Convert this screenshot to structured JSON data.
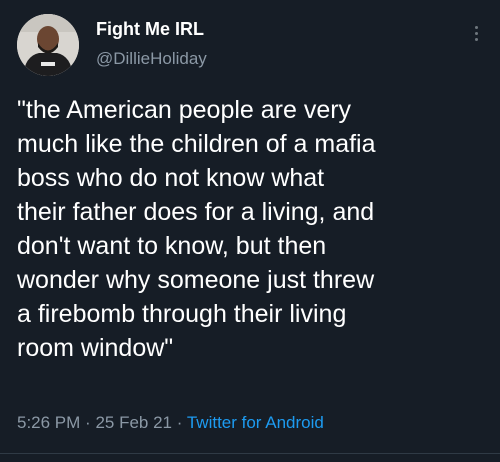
{
  "user": {
    "display_name": "Fight Me IRL",
    "handle": "@DillieHoliday"
  },
  "tweet": {
    "lines": [
      "\"the American people are very",
      "much like the children of a mafia",
      "boss who do not know what",
      "their father does for a living, and",
      "don't want to know, but then",
      "wonder why someone just threw",
      "a firebomb through their living",
      "room window\""
    ],
    "time": "5:26 PM",
    "separator": "·",
    "date": "25 Feb 21",
    "source": "Twitter for Android"
  },
  "icons": {
    "more": "more-vertical-icon"
  },
  "colors": {
    "background": "#161d26",
    "text": "#ffffff",
    "secondary": "#8b98a5",
    "link": "#1d9bf0"
  }
}
